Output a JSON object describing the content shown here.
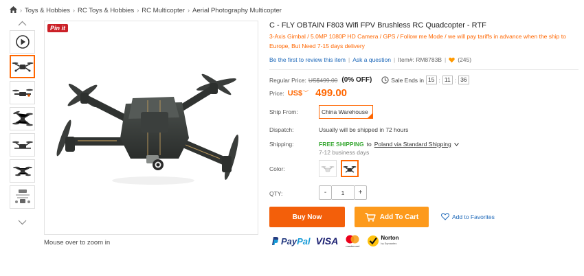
{
  "breadcrumb": {
    "items": [
      "Toys & Hobbies",
      "RC Toys & Hobbies",
      "RC Multicopter",
      "Aerial Photography Multicopter"
    ]
  },
  "image_panel": {
    "pin_label": "Pin it",
    "zoom_hint": "Mouse over to zoom in",
    "thumbnails": [
      "play-video",
      "drone-front",
      "drone-side",
      "drone-top",
      "drone-angle",
      "drone-folded",
      "drone-accessories"
    ]
  },
  "product": {
    "title": "C - FLY OBTAIN F803 Wifi FPV Brushless RC Quadcopter - RTF",
    "subtitle": "3-Axis Gimbal / 5.0MP 1080P HD Camera / GPS / Follow me Mode / we will pay tariffs in advance when the ship to Europe, But Need 7-15 days delivery",
    "review_link": "Be the first to review this item",
    "ask_link": "Ask a question",
    "item_no": "Item#: RM8783B",
    "favorites_count": "(245)"
  },
  "pricing": {
    "regular_label": "Regular Price:",
    "regular_price": "US$499.00",
    "discount": "(0% OFF)",
    "sale_ends_label": "Sale Ends in",
    "timer": [
      "15",
      "11",
      "36"
    ],
    "price_label": "Price:",
    "currency": "US$",
    "price": "499.00"
  },
  "shipping": {
    "ship_from_label": "Ship From:",
    "ship_from_value": "China Warehouse",
    "dispatch_label": "Dispatch:",
    "dispatch_value": "Usually will be shipped in 72 hours",
    "shipping_label": "Shipping:",
    "free_shipping": "FREE SHIPPING",
    "to_text": "to",
    "destination": "Poland via Standard Shipping",
    "business_days": "7-12 business days"
  },
  "options": {
    "color_label": "Color:",
    "qty_label": "QTY:",
    "qty_value": "1",
    "minus": "-",
    "plus": "+"
  },
  "actions": {
    "buy_now": "Buy Now",
    "add_to_cart": "Add To Cart",
    "add_to_favorites": "Add to Favorites"
  },
  "payments": {
    "paypal_1": "Pay",
    "paypal_2": "Pal",
    "visa": "VISA",
    "mastercard": "mastercard",
    "norton": "Norton",
    "norton_sub": "by Symantec"
  },
  "colors": {
    "accent": "#ff6600",
    "buy": "#f35f0a",
    "cart": "#fd9a1c",
    "link": "#1a66b8",
    "free": "#3aa935"
  }
}
